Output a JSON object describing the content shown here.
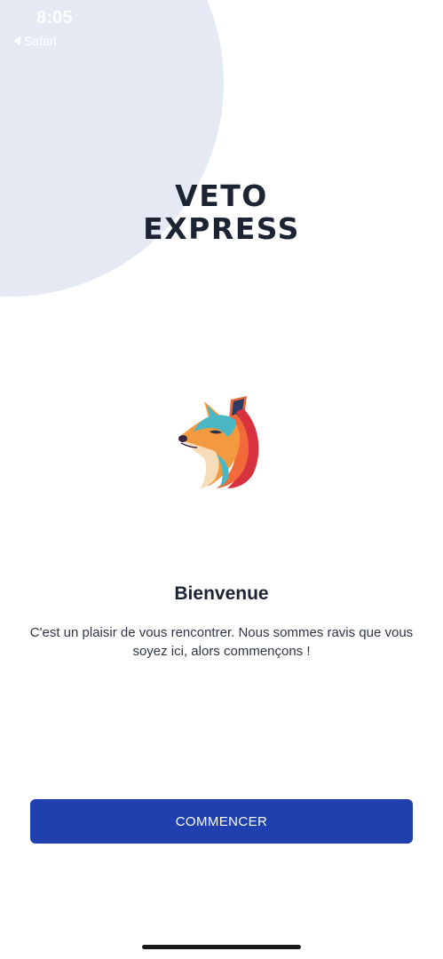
{
  "status_bar": {
    "time": "8:05",
    "back_label": "Safari"
  },
  "brand": {
    "line1": "VETO",
    "line2": "EXPRESS"
  },
  "welcome": {
    "title": "Bienvenue",
    "message": "C'est un plaisir de vous rencontrer. Nous sommes ravis que vous soyez ici, alors commençons !"
  },
  "cta": {
    "label": "COMMENCER"
  },
  "colors": {
    "primary": "#1f40ae",
    "text_dark": "#1c2434",
    "decor_circle": "#e4e9f3"
  },
  "icons": {
    "mascot": "fox-logo-icon",
    "back": "back-arrow-icon"
  }
}
